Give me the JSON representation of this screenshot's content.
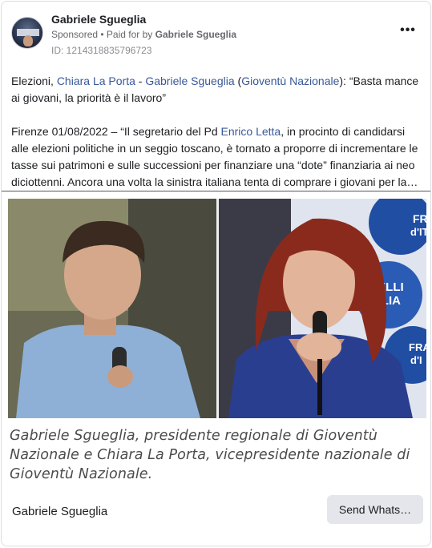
{
  "post": {
    "page_name": "Gabriele Sgueglia",
    "sponsored_label": "Sponsored",
    "paid_for_prefix": " • Paid for by ",
    "paid_for_name": "Gabriele Sgueglia",
    "ad_id": "ID: 1214318835796723",
    "more_label": "•••",
    "avatar_icon": "profile-avatar"
  },
  "body": {
    "p1_lead": "Elezioni, ",
    "p1_link1": "Chiara La Porta",
    "p1_sep": " - ",
    "p1_link2": "Gabriele Sgueglia",
    "p1_open": " (",
    "p1_link3": "Gioventù Nazionale",
    "p1_tail": "): “Basta mance ai giovani, la priorità è il lavoro”",
    "p2_lead": "Firenze 01/08/2022 – “Il segretario del Pd ",
    "p2_link": "Enrico Letta",
    "p2_tail": ", in procinto di candidarsi alle elezioni politiche in un seggio toscano, è tornato a proporre di incrementare le tasse sui patrimoni e sulle successioni per finanziare una “dote” finanziaria ai neo diciottenni. Ancora una volta la sinistra italiana tenta di comprare i giovani per la…"
  },
  "image": {
    "caption": "Gabriele Sgueglia, presidente regionale di Gioventù Nazionale e Chiara La Porta, vicepresidente nazionale di Gioventù Nazionale.",
    "banner_text_1": "FRA",
    "banner_text_2": "d'IT",
    "banner_text_3": "TELLI",
    "banner_text_4": "ALIA",
    "banner_text_5": "FRA",
    "banner_text_6": "d'I"
  },
  "footer": {
    "name": "Gabriele Sgueglia",
    "cta_label": "Send Whats…"
  },
  "colors": {
    "link": "#385898",
    "cta_bg": "#e4e6eb",
    "banner_blue": "#1f4ea3"
  }
}
